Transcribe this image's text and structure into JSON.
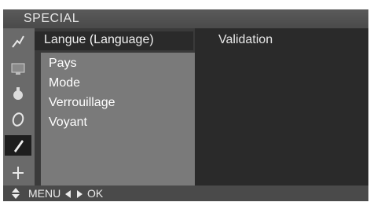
{
  "header": {
    "title": "SPECIAL"
  },
  "sidebar": {
    "icons": [
      {
        "name": "picture-icon"
      },
      {
        "name": "screen-icon"
      },
      {
        "name": "sound-icon"
      },
      {
        "name": "timer-icon"
      },
      {
        "name": "special-icon",
        "selected": true
      },
      {
        "name": "setup-icon"
      }
    ]
  },
  "menu": {
    "selected_item": "Langue (Language)",
    "sub_items": [
      "Pays",
      "Mode",
      "Verrouillage",
      "Voyant"
    ]
  },
  "right_pane": {
    "value": "Validation"
  },
  "footer": {
    "menu_label": "MENU",
    "ok_label": "OK"
  },
  "colors": {
    "background": "#3a3a3a",
    "icon_column": "#6a6a6a",
    "submenu": "#7a7a7a",
    "text": "#ffffff"
  }
}
